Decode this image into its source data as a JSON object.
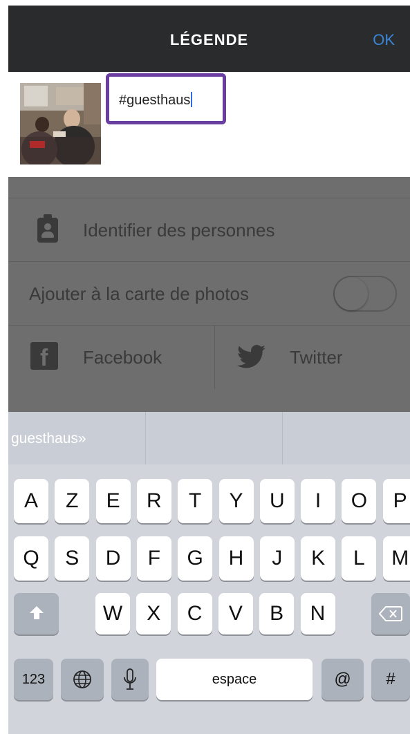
{
  "header": {
    "title": "LÉGENDE",
    "ok_label": "OK"
  },
  "caption": {
    "text": "#guesthaus"
  },
  "options": {
    "tag_people_label": "Identifier des personnes",
    "photo_map_label": "Ajouter à la carte de photos",
    "photo_map_enabled": false,
    "share": [
      {
        "label": "Facebook",
        "icon": "facebook-icon"
      },
      {
        "label": "Twitter",
        "icon": "twitter-icon"
      }
    ]
  },
  "keyboard": {
    "suggestion": "guesthaus»",
    "row1": [
      "A",
      "Z",
      "E",
      "R",
      "T",
      "Y",
      "U",
      "I",
      "O",
      "P"
    ],
    "row2": [
      "Q",
      "S",
      "D",
      "F",
      "G",
      "H",
      "J",
      "K",
      "L",
      "M"
    ],
    "row3": [
      "W",
      "X",
      "C",
      "V",
      "B",
      "N"
    ],
    "numbers_label": "123",
    "space_label": "espace",
    "at_label": "@",
    "hash_label": "#"
  },
  "colors": {
    "header_bg": "#2a2b2d",
    "accent": "#3a86d6",
    "highlight": "#6a3ea0"
  }
}
